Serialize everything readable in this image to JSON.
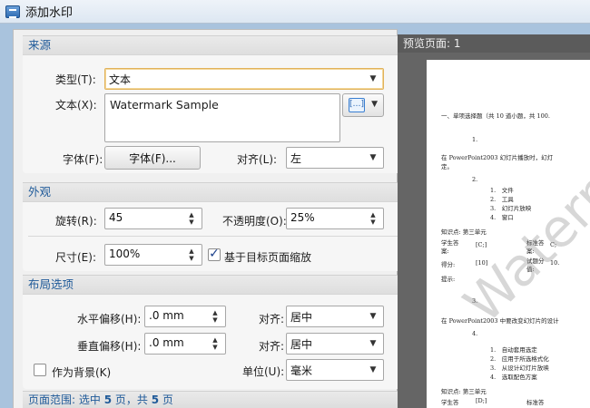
{
  "window": {
    "title": "添加水印"
  },
  "source": {
    "header": "来源",
    "type_label": "类型(T):",
    "type_value": "文本",
    "text_label": "文本(X):",
    "text_value": "Watermark Sample",
    "font_label": "字体(F):",
    "font_button": "字体(F)...",
    "align_label": "对齐(L):",
    "align_value": "左"
  },
  "appearance": {
    "header": "外观",
    "rotation_label": "旋转(R):",
    "rotation_value": "45",
    "opacity_label": "不透明度(O):",
    "opacity_value": "25%",
    "size_label": "尺寸(E):",
    "size_value": "100%",
    "scale_label": "基于目标页面缩放",
    "scale_checked": true
  },
  "layout": {
    "header": "布局选项",
    "h_offset_label": "水平偏移(H):",
    "h_offset_value": ".0 mm",
    "v_offset_label": "垂直偏移(H):",
    "v_offset_value": ".0 mm",
    "align_label": "对齐:",
    "h_align_value": "居中",
    "v_align_value": "居中",
    "background_label": "作为背景(K)",
    "background_checked": false,
    "unit_label": "单位(U):",
    "unit_value": "毫米"
  },
  "status": {
    "prefix": "页面范围: 选中",
    "selected": "5",
    "middle": "页，共",
    "total": "5",
    "suffix": "页"
  },
  "preview": {
    "header": "预览页面: 1",
    "watermark": "Watermark",
    "lines": [
      "一、单项选择题（共 10 道小题，共 100.",
      "1.",
      "在 PowerPoint2003 幻灯片播放时，幻灯",
      "定。",
      "2.",
      "1.　文件",
      "2.　工具",
      "3.　幻灯片放映",
      "4.　窗口",
      "知识点: 第三单元",
      "学生答",
      "案:",
      "[C;]",
      "标准答",
      "案:",
      "C;",
      "得分:",
      "[10]",
      "试题分",
      "值:",
      "10.",
      "提示:",
      "3.",
      "在 PowerPoint2003 中要改变幻灯片的设计",
      "4.",
      "1.　自动套用选定",
      "2.　应用于所选格式化",
      "3.　从设计幻灯片放映",
      "4.　选取配色方案",
      "知识点: 第三单元",
      "学生答",
      "[D;]",
      "标准答"
    ]
  },
  "icons": {
    "app": "watermark-app-icon",
    "insert": "insert-field-icon",
    "dropdown": "chevron-down-icon",
    "spinner": "spinner-arrows-icon",
    "check": "checkmark-icon"
  },
  "colors": {
    "group_header_text": "#1f5a99",
    "focus_border": "#e1b25a",
    "preview_background": "#656565"
  }
}
